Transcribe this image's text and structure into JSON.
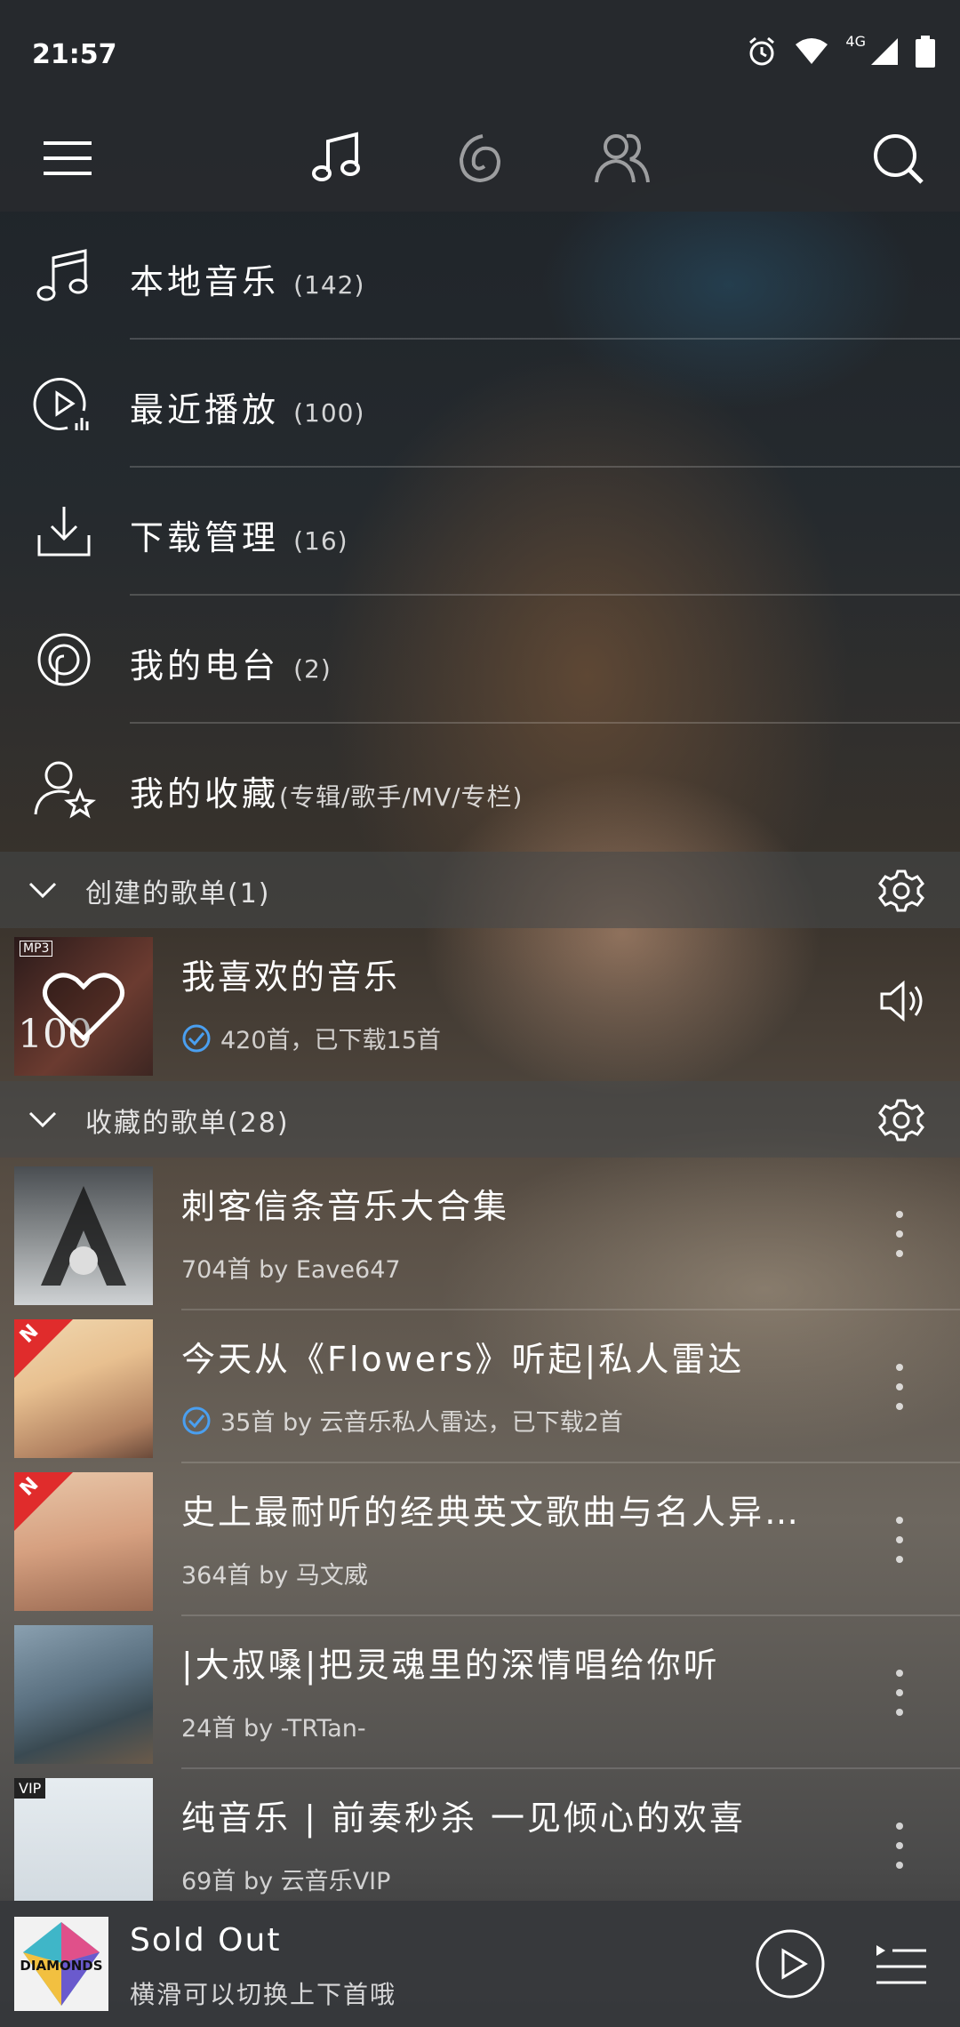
{
  "status": {
    "time": "21:57",
    "network": "4G",
    "icons": [
      "alarm-icon",
      "wifi-icon",
      "signal-icon",
      "battery-icon"
    ]
  },
  "nav": {
    "tabs": [
      {
        "name": "music-note-icon",
        "active": true
      },
      {
        "name": "radio-wave-icon",
        "active": false
      },
      {
        "name": "friends-icon",
        "active": false
      }
    ],
    "menu_icon": "hamburger-menu-icon",
    "search_icon": "search-icon"
  },
  "menu": [
    {
      "label": "本地音乐",
      "count": "(142)",
      "icon": "music-note-icon"
    },
    {
      "label": "最近播放",
      "count": "(100)",
      "icon": "recent-play-icon"
    },
    {
      "label": "下载管理",
      "count": "(16)",
      "icon": "download-icon"
    },
    {
      "label": "我的电台",
      "count": "(2)",
      "icon": "podcast-icon"
    },
    {
      "label": "我的收藏",
      "count": "(专辑/歌手/MV/专栏)",
      "icon": "favorite-user-icon"
    }
  ],
  "created_section": {
    "title": "创建的歌单(1)",
    "playlists": [
      {
        "title": "我喜欢的音乐",
        "subtitle": "420首，已下载15首",
        "downloaded": true
      }
    ]
  },
  "collected_section": {
    "title": "收藏的歌单(28)",
    "playlists": [
      {
        "title": "刺客信条音乐大合集",
        "subtitle": "704首 by Eave647",
        "downloaded": false,
        "badge": ""
      },
      {
        "title": "今天从《Flowers》听起|私人雷达",
        "subtitle": "35首 by 云音乐私人雷达，已下载2首",
        "downloaded": true,
        "badge": "N"
      },
      {
        "title": "史上最耐听的经典英文歌曲与名人异…",
        "subtitle": "364首 by 马文威",
        "downloaded": false,
        "badge": "N"
      },
      {
        "title": "|大叔嗓|把灵魂里的深情唱给你听",
        "subtitle": "24首 by -TRTan-",
        "downloaded": false,
        "badge": ""
      },
      {
        "title": "纯音乐 | 前奏秒杀 一见倾心的欢喜",
        "subtitle": "69首 by 云音乐VIP",
        "downloaded": false,
        "badge": "VIP"
      }
    ]
  },
  "player": {
    "title": "Sold Out",
    "subtitle": "横滑可以切换上下首哦",
    "cover_text": "DIAMONDS"
  },
  "cover_texts": {
    "mp3_tag": "MP3",
    "album_number": "100"
  },
  "colors": {
    "badge_red": "#e02c2c",
    "check_blue": "#4a9ff0"
  }
}
